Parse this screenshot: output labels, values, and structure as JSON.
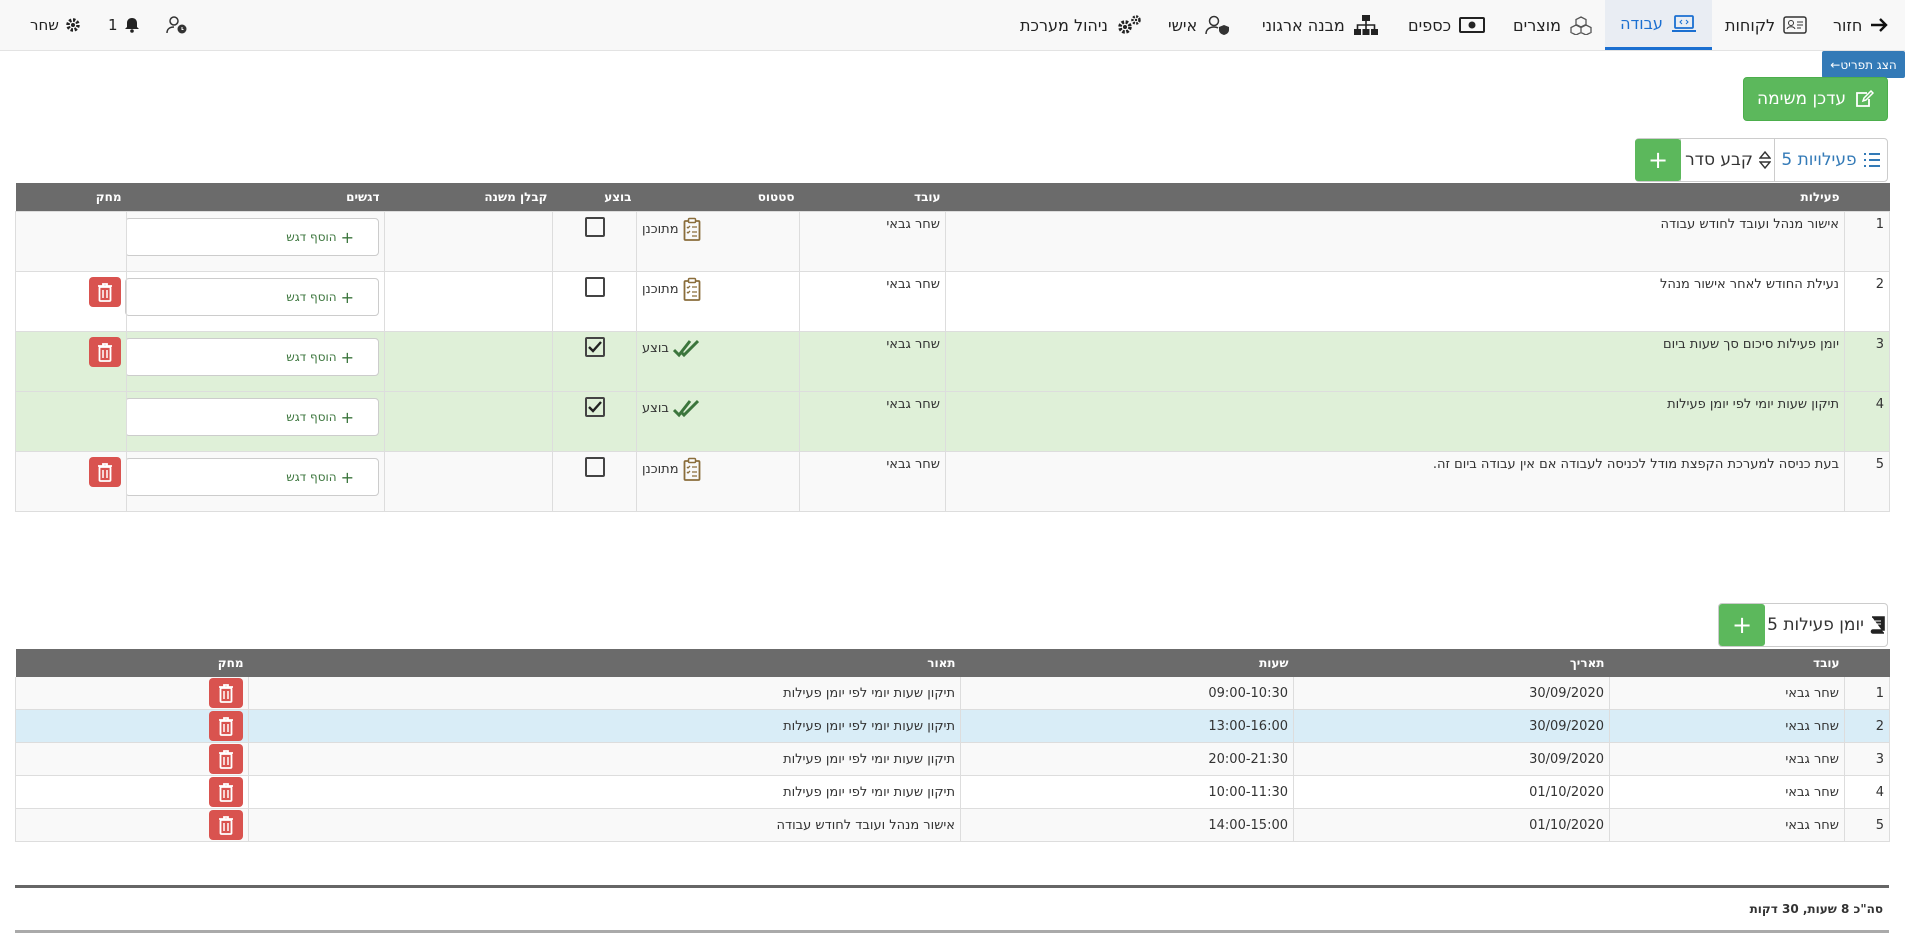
{
  "nav": {
    "back": "חזור",
    "customers": "לקוחות",
    "work": "עבודה",
    "products": "מוצרים",
    "money": "כספים",
    "org": "מבנה ארגוני",
    "personal": "אישי",
    "sysadmin": "ניהול מערכת",
    "notif_count": "1",
    "user": "שחר"
  },
  "menu_toggle": "הצג תפריט←",
  "update_task": "עדכן משימה",
  "activities": {
    "header_label": "פעילויות 5",
    "sort_label": "קבע סדר",
    "columns": [
      "פעילות",
      "עובד",
      "סטטוס",
      "בוצע",
      "קבלן משנה",
      "דגשים",
      "מחק"
    ],
    "add_note": "הוסף דגש",
    "rows": [
      {
        "num": "1",
        "activity": "אישור מנהל ועובד לחודש עבודה",
        "worker": "שחר גבאי",
        "status": "מתוכנן",
        "done": false,
        "deletable": false
      },
      {
        "num": "2",
        "activity": "נעילת החודש לאחר אישור מנהל",
        "worker": "שחר גבאי",
        "status": "מתוכנן",
        "done": false,
        "deletable": true
      },
      {
        "num": "3",
        "activity": "יומן פעילות סיכום סך שעות ביום",
        "worker": "שחר גבאי",
        "status": "בוצע",
        "done": true,
        "deletable": true
      },
      {
        "num": "4",
        "activity": "תיקון שעות יומי לפי יומן פעילות",
        "worker": "שחר גבאי",
        "status": "בוצע",
        "done": true,
        "deletable": false
      },
      {
        "num": "5",
        "activity": "בעת כניסה למערכת הקפצת מודל לכניסה לעבודה אם אין עבודה ביום זה.",
        "worker": "שחר גבאי",
        "status": "מתוכנן",
        "done": false,
        "deletable": true
      }
    ]
  },
  "log": {
    "header_label": "יומן פעילות 5",
    "columns": [
      "עובד",
      "תאריך",
      "שעות",
      "תאור",
      "מחק"
    ],
    "rows": [
      {
        "num": "1",
        "worker": "שחר גבאי",
        "date": "30/09/2020",
        "hours": "09:00-10:30",
        "desc": "תיקון שעות יומי לפי יומן פעילות"
      },
      {
        "num": "2",
        "worker": "שחר גבאי",
        "date": "30/09/2020",
        "hours": "13:00-16:00",
        "desc": "תיקון שעות יומי לפי יומן פעילות"
      },
      {
        "num": "3",
        "worker": "שחר גבאי",
        "date": "30/09/2020",
        "hours": "20:00-21:30",
        "desc": "תיקון שעות יומי לפי יומן פעילות"
      },
      {
        "num": "4",
        "worker": "שחר גבאי",
        "date": "01/10/2020",
        "hours": "10:00-11:30",
        "desc": "תיקון שעות יומי לפי יומן פעילות"
      },
      {
        "num": "5",
        "worker": "שחר גבאי",
        "date": "01/10/2020",
        "hours": "14:00-15:00",
        "desc": "אישור מנהל ועובד לחודש עבודה"
      }
    ],
    "total": "סה\"כ 8 שעות, 30 דקות"
  }
}
